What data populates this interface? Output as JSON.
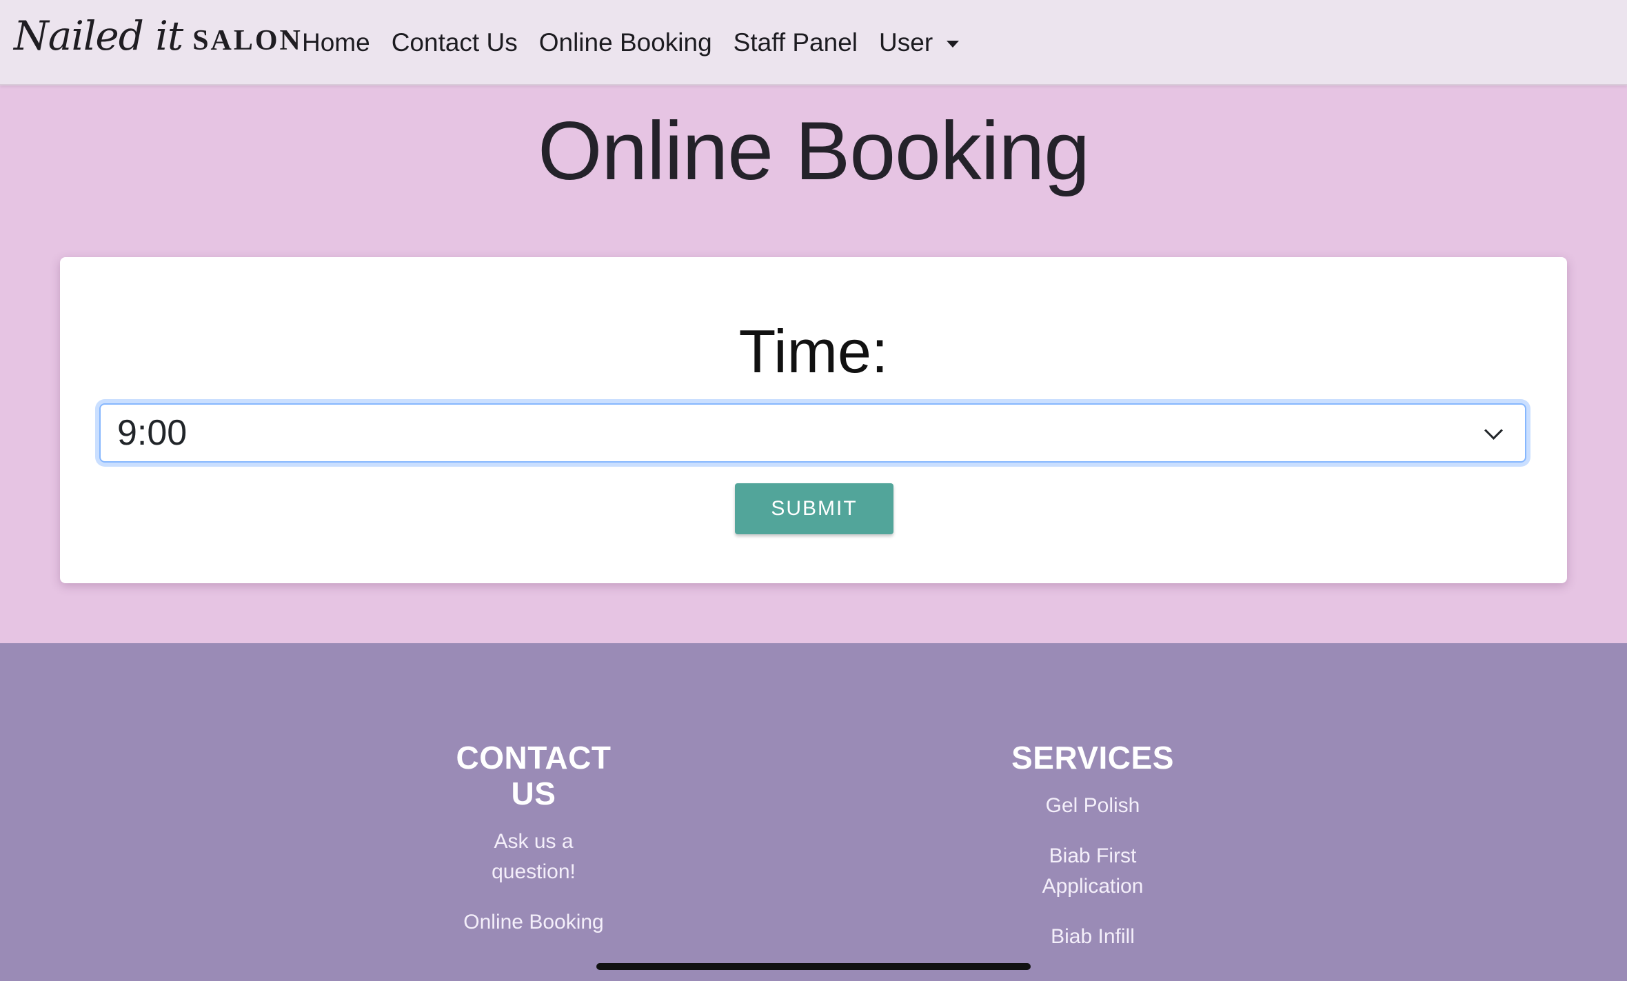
{
  "brand": {
    "script": "Nailed it",
    "name": "SALON"
  },
  "nav": {
    "items": [
      {
        "label": "Home"
      },
      {
        "label": "Contact Us"
      },
      {
        "label": "Online Booking"
      },
      {
        "label": "Staff Panel"
      }
    ],
    "user_label": "User"
  },
  "page": {
    "title": "Online Booking"
  },
  "form": {
    "time_label": "Time:",
    "time_selected": "9:00",
    "submit_label": "SUBMIT"
  },
  "footer": {
    "contact": {
      "heading": "CONTACT US",
      "links": [
        "Ask us a question!",
        "Online Booking"
      ]
    },
    "services": {
      "heading": "SERVICES",
      "links": [
        "Gel Polish",
        "Biab First Application",
        "Biab Infill"
      ]
    }
  },
  "colors": {
    "page_background": "#e6c4e3",
    "navbar_background": "#ece4ee",
    "footer_background": "#9a8bb6",
    "submit_button": "#52a59a",
    "focus_ring": "#86b7fe"
  }
}
